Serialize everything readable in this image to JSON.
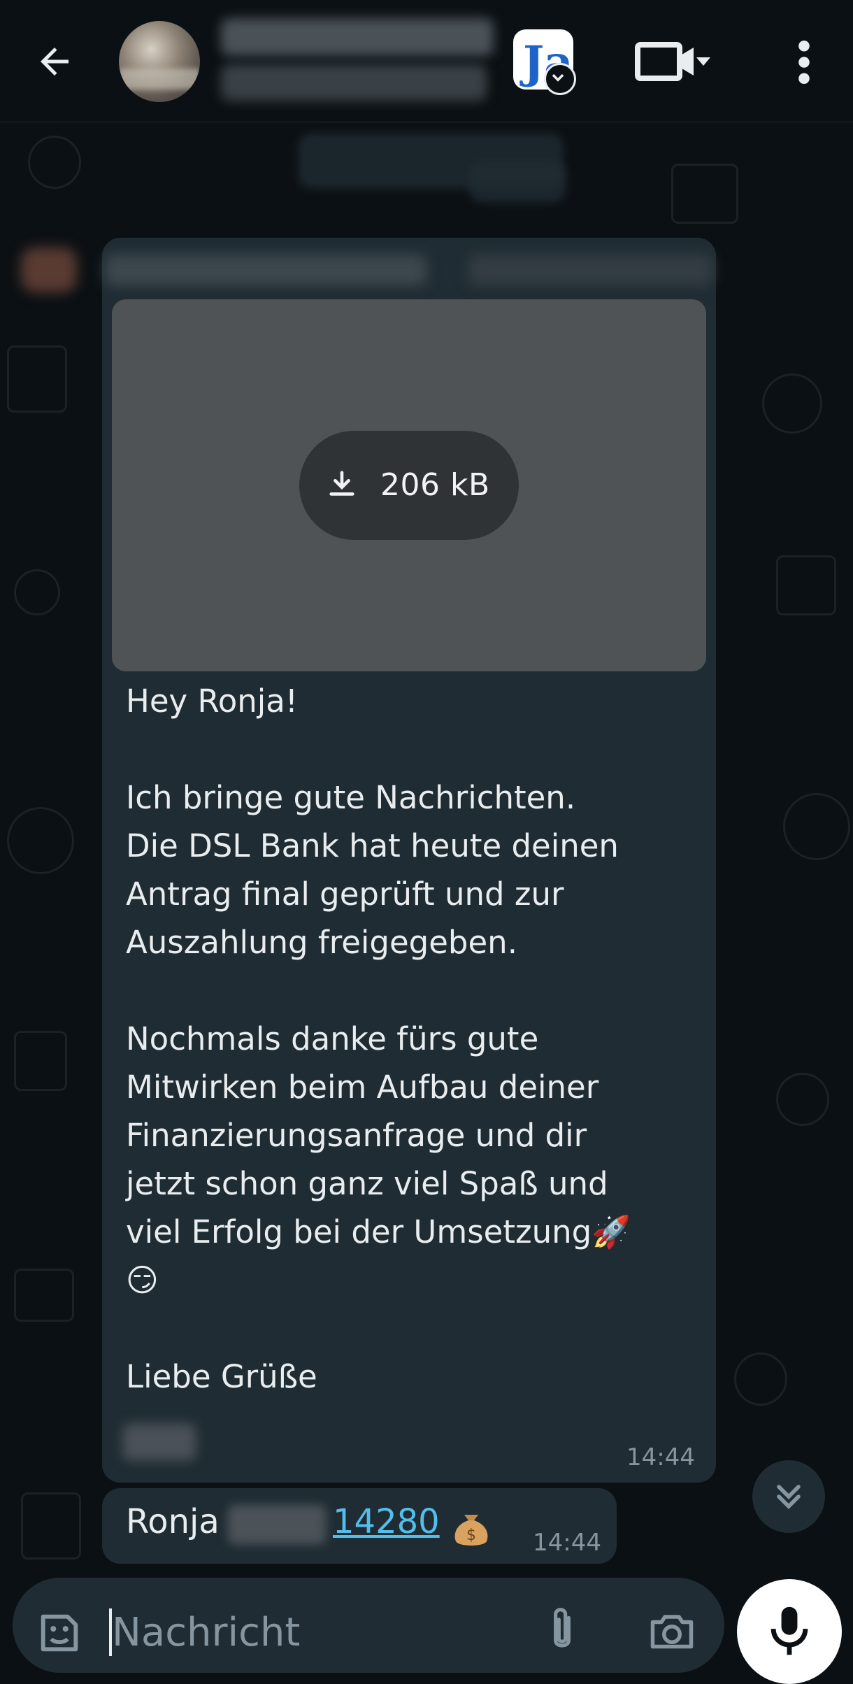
{
  "header": {
    "back_label": "back",
    "icons": [
      "arrow-left-icon",
      "video-camera-icon",
      "caret-down-icon",
      "more-vert-icon"
    ]
  },
  "message1": {
    "attachment_size": "206 kB",
    "text": "Hey Ronja!\n\nIch bringe gute Nachrichten.\nDie DSL Bank hat heute deinen\nAntrag final geprüft und zur\nAuszahlung freigegeben.\n\nNochmals danke fürs gute\nMitwirken beim Aufbau deiner\nFinanzierungsanfrage und dir\njetzt schon ganz viel Spaß und\nviel Erfolg bei der Umsetzung🚀\n😏\n\nLiebe Grüße",
    "time": "14:44"
  },
  "message2": {
    "name": "Ronja",
    "number": "14280",
    "time": "14:44"
  },
  "composer": {
    "placeholder": "Nachricht"
  },
  "colors": {
    "background": "#0b1014",
    "bubble": "#202c33",
    "link": "#53bdeb",
    "meta": "#8696a0"
  }
}
